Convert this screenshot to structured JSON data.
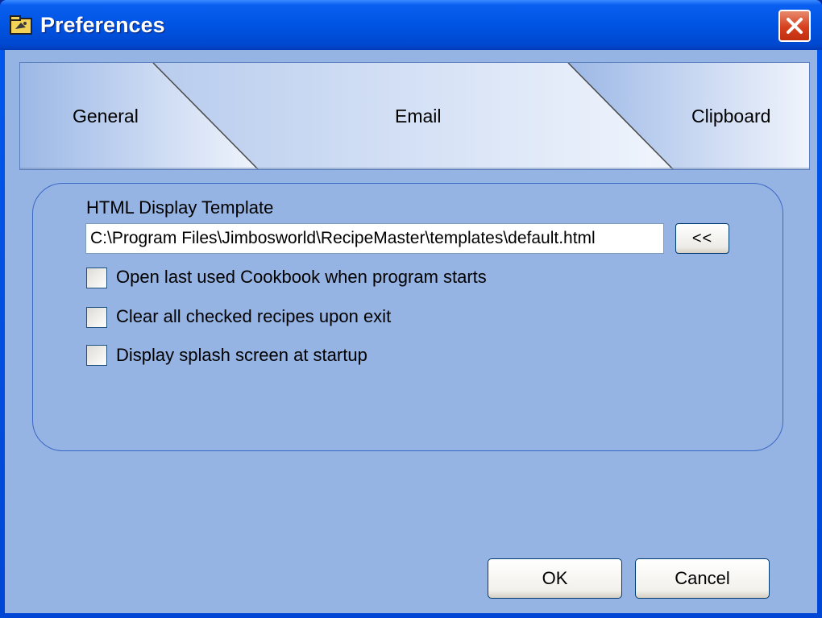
{
  "window": {
    "title": "Preferences"
  },
  "tabs": [
    {
      "label": "General"
    },
    {
      "label": "Email"
    },
    {
      "label": "Clipboard"
    }
  ],
  "general": {
    "template_label": "HTML Display Template",
    "template_path": "C:\\Program Files\\Jimbosworld\\RecipeMaster\\templates\\default.html",
    "browse_label": "<<",
    "options": [
      {
        "label": "Open last used Cookbook when program starts",
        "checked": false
      },
      {
        "label": "Clear all checked recipes upon exit",
        "checked": false
      },
      {
        "label": "Display splash screen at startup",
        "checked": false
      }
    ]
  },
  "buttons": {
    "ok": "OK",
    "cancel": "Cancel"
  },
  "colors": {
    "titlebar": "#0054e3",
    "client": "#95b3e3",
    "close": "#d6401e"
  }
}
